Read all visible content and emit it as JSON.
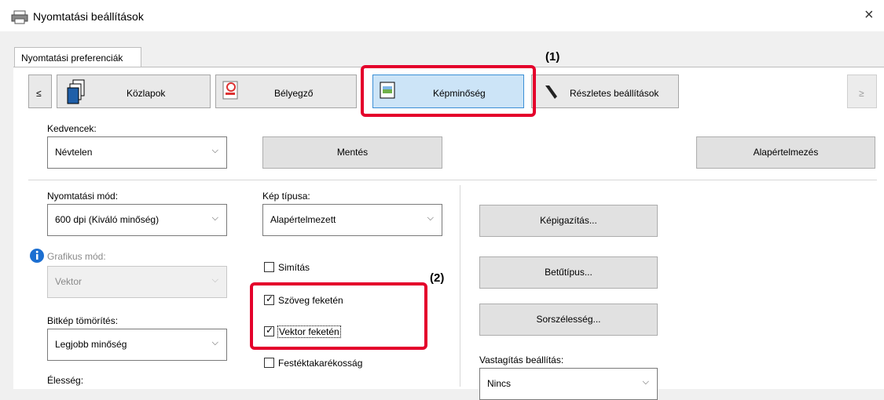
{
  "window": {
    "title": "Nyomtatási beállítások",
    "close_glyph": "×"
  },
  "tabs": [
    {
      "label": "Nyomtatási preferenciák"
    }
  ],
  "nav": {
    "prev": "≤",
    "next": "≥",
    "items": [
      {
        "label": "Közlapok",
        "icon": "pages-icon"
      },
      {
        "label": "Bélyegző",
        "icon": "stamp-icon"
      },
      {
        "label": "Képminőség",
        "icon": "image-quality-icon",
        "selected": true
      },
      {
        "label": "Részletes beállítások",
        "icon": "wrench-icon"
      }
    ]
  },
  "callouts": {
    "c1": "(1)",
    "c2": "(2)"
  },
  "favorites": {
    "label": "Kedvencek:",
    "value": "Névtelen",
    "save": "Mentés",
    "default": "Alapértelmezés"
  },
  "print_mode": {
    "label": "Nyomtatási mód:",
    "value": "600 dpi (Kiváló minőség)"
  },
  "graphics_mode": {
    "label": "Grafikus mód:",
    "value": "Vektor"
  },
  "bitmap_compression": {
    "label": "Bitkép tömörítés:",
    "value": "Legjobb minőség"
  },
  "sharpness": {
    "label": "Élesség:"
  },
  "image_type": {
    "label": "Kép típusa:",
    "value": "Alapértelmezett"
  },
  "checkboxes": {
    "smoothing": {
      "label": "Simítás",
      "checked": false
    },
    "text_black": {
      "label": "Szöveg feketén",
      "checked": true
    },
    "vector_black": {
      "label": "Vektor feketén",
      "checked": true
    },
    "toner_save": {
      "label": "Festéktakarékosság",
      "checked": false
    }
  },
  "buttons": {
    "image_adjust": "Képigazítás...",
    "font": "Betűtípus...",
    "line_spacing": "Sorszélesség..."
  },
  "thickening": {
    "label": "Vastagítás beállítás:",
    "value": "Nincs"
  },
  "colors": {
    "highlight": "#e4002b",
    "selected_bg": "#cce4f7"
  }
}
